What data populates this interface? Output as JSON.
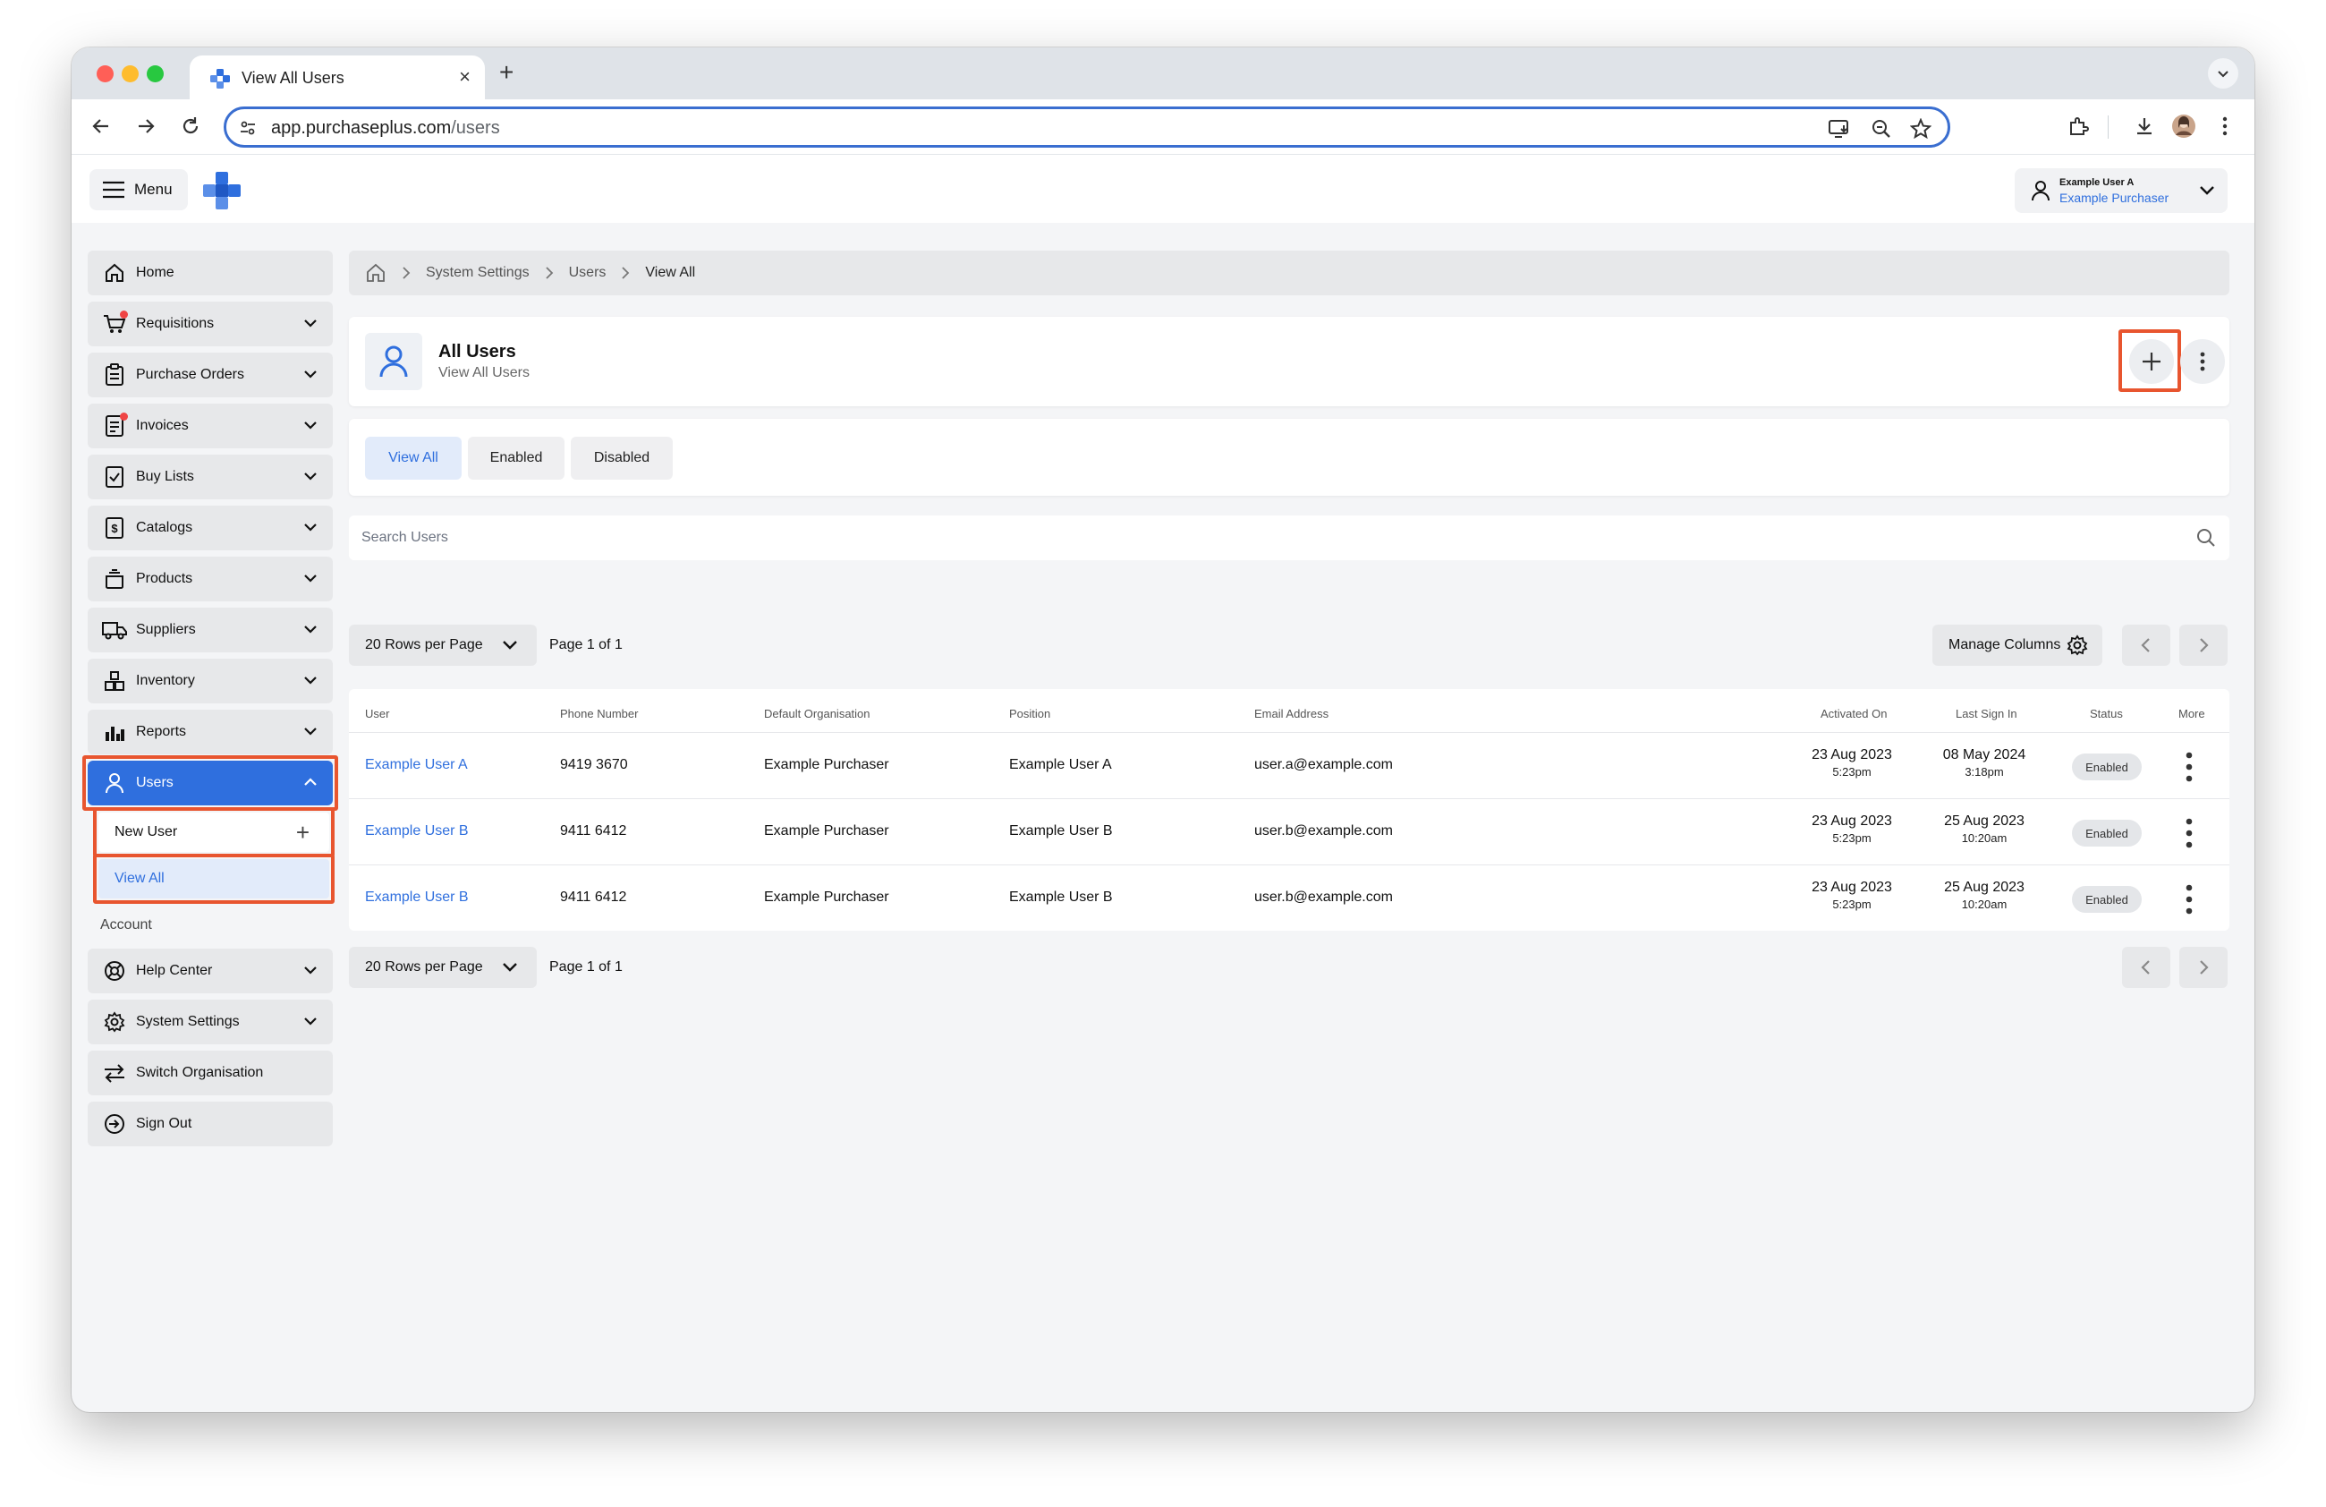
{
  "browser": {
    "tab_title": "View All Users",
    "url_host": "app.purchaseplus.com",
    "url_path": "/users"
  },
  "header": {
    "menu_label": "Menu",
    "account_name": "Example User A",
    "account_org": "Example Purchaser"
  },
  "sidebar": {
    "items": [
      {
        "label": "Home",
        "icon": "home-icon"
      },
      {
        "label": "Requisitions",
        "icon": "cart-icon"
      },
      {
        "label": "Purchase Orders",
        "icon": "clipboard-icon"
      },
      {
        "label": "Invoices",
        "icon": "invoice-icon"
      },
      {
        "label": "Buy Lists",
        "icon": "checklist-icon"
      },
      {
        "label": "Catalogs",
        "icon": "catalog-icon"
      },
      {
        "label": "Products",
        "icon": "box-icon"
      },
      {
        "label": "Suppliers",
        "icon": "truck-icon"
      },
      {
        "label": "Inventory",
        "icon": "inventory-icon"
      },
      {
        "label": "Reports",
        "icon": "chart-icon"
      },
      {
        "label": "Users",
        "icon": "user-icon"
      }
    ],
    "sub_items": [
      {
        "label": "New User"
      },
      {
        "label": "View All"
      }
    ],
    "account_heading": "Account",
    "account_items": [
      {
        "label": "Help Center",
        "icon": "lifebuoy-icon"
      },
      {
        "label": "System Settings",
        "icon": "gear-icon"
      },
      {
        "label": "Switch Organisation",
        "icon": "switch-icon"
      },
      {
        "label": "Sign Out",
        "icon": "signout-icon"
      }
    ]
  },
  "breadcrumb": [
    "System Settings",
    "Users",
    "View All"
  ],
  "page": {
    "title": "All Users",
    "subtitle": "View All Users"
  },
  "filters": [
    "View All",
    "Enabled",
    "Disabled"
  ],
  "search": {
    "placeholder": "Search Users"
  },
  "pagination": {
    "rows_per_page": "20 Rows per Page",
    "page_info": "Page 1 of 1",
    "manage_columns": "Manage Columns"
  },
  "table": {
    "columns": [
      "User",
      "Phone Number",
      "Default Organisation",
      "Position",
      "Email Address",
      "Activated On",
      "Last Sign In",
      "Status",
      "More"
    ],
    "rows": [
      {
        "user": "Example User A",
        "phone": "9419 3670",
        "org": "Example Purchaser",
        "position": "Example User A",
        "email": "user.a@example.com",
        "activated_date": "23 Aug 2023",
        "activated_time": "5:23pm",
        "last_date": "08 May 2024",
        "last_time": "3:18pm",
        "status": "Enabled"
      },
      {
        "user": "Example User B",
        "phone": "9411 6412",
        "org": "Example Purchaser",
        "position": "Example User B",
        "email": "user.b@example.com",
        "activated_date": "23 Aug 2023",
        "activated_time": "5:23pm",
        "last_date": "25 Aug 2023",
        "last_time": "10:20am",
        "status": "Enabled"
      },
      {
        "user": "Example User B",
        "phone": "9411 6412",
        "org": "Example Purchaser",
        "position": "Example User B",
        "email": "user.b@example.com",
        "activated_date": "23 Aug 2023",
        "activated_time": "5:23pm",
        "last_date": "25 Aug 2023",
        "last_time": "10:20am",
        "status": "Enabled"
      }
    ]
  },
  "colors": {
    "accent": "#2f6fde",
    "highlight": "#e8552f"
  }
}
